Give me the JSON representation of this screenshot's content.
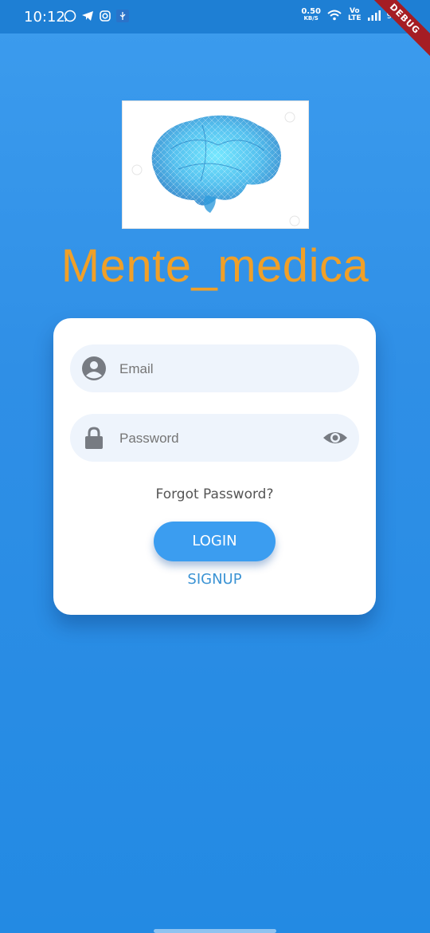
{
  "status_bar": {
    "time": "10:12",
    "speed_value": "0.50",
    "speed_unit": "KB/S",
    "volte_top": "Vo",
    "volte_bottom": "LTE",
    "battery": "90%"
  },
  "debug_banner": "DEBUG",
  "app": {
    "title": "Mente_medica"
  },
  "login_form": {
    "email_placeholder": "Email",
    "password_placeholder": "Password",
    "forgot_label": "Forgot Password?",
    "login_label": "LOGIN",
    "signup_label": "SIGNUP"
  },
  "colors": {
    "accent": "#3b9df0",
    "title": "#f0a028",
    "background": "#2f8fe6"
  },
  "icons": {
    "email": "account-circle-icon",
    "password": "lock-icon",
    "toggle": "eye-icon"
  }
}
